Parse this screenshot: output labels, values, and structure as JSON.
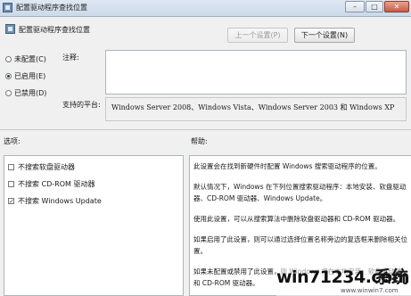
{
  "window": {
    "title": "配置驱动程序查找位置",
    "controls": {
      "minimize": "–",
      "maximize": "□",
      "close": "✕"
    }
  },
  "header": {
    "title": "配置驱动程序查找位置",
    "prev_button": "上一个设置(P)",
    "next_button": "下一个设置(N)"
  },
  "state": {
    "options": [
      {
        "label": "未配置(C)",
        "checked": false
      },
      {
        "label": "已启用(E)",
        "checked": true
      },
      {
        "label": "已禁用(D)",
        "checked": false
      }
    ]
  },
  "comment": {
    "label": "注释:",
    "value": ""
  },
  "platform": {
    "label": "支持的平台:",
    "value": "Windows Server 2008、Windows Vista、Windows Server 2003 和 Windows XP"
  },
  "options_panel": {
    "label": "选项:",
    "items": [
      {
        "label": "不搜索软盘驱动器",
        "checked": false
      },
      {
        "label": "不搜索 CD-ROM 驱动器",
        "checked": false
      },
      {
        "label": "不搜索 Windows Update",
        "checked": true
      }
    ]
  },
  "help_panel": {
    "label": "帮助:",
    "paragraphs": [
      "此设置会在找到新硬件时配置 Windows 搜索驱动程序的位置。",
      "默认情况下，Windows 在下列位置搜索驱动程序：本地安装、软盘驱动器、CD-ROM 驱动器、Windows Update。",
      "使用此设置，可以从搜索算法中删除软盘驱动器和 CD-ROM 驱动器。",
      "如果启用了此设置，则可以通过选择位置名称旁边的复选框来删除相关位置。",
      "如果未配置或禁用了此设置，则 Windows 将在本地安装、软盘驱动器和 CD-ROM 驱动器。"
    ]
  },
  "watermark": {
    "text": "win71234.com",
    "cn": "系统",
    "url": "www.winwin7.com"
  }
}
